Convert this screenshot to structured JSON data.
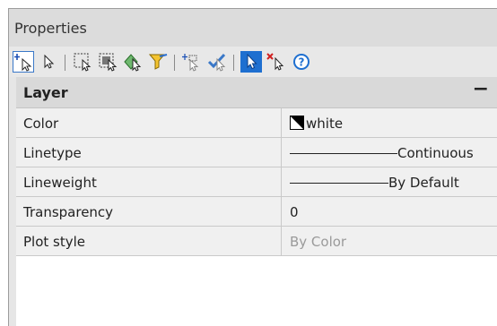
{
  "panel": {
    "title": "Properties"
  },
  "toolbar": {
    "buttons": [
      {
        "name": "quick-select-add-icon"
      },
      {
        "name": "select-objects-icon"
      },
      {
        "name": "window-select-icon"
      },
      {
        "name": "crossing-select-icon"
      },
      {
        "name": "select-similar-icon"
      },
      {
        "name": "filter-select-icon"
      },
      {
        "name": "select-subobjects-icon"
      },
      {
        "name": "pickadd-toggle-icon"
      },
      {
        "name": "pickadd-active-icon"
      },
      {
        "name": "deselect-icon"
      },
      {
        "name": "help-icon"
      }
    ]
  },
  "section": {
    "title": "Layer",
    "collapse_symbol": "−"
  },
  "rows": [
    {
      "label": "Color",
      "value": "white",
      "kind": "color"
    },
    {
      "label": "Linetype",
      "value": "Continuous",
      "kind": "line"
    },
    {
      "label": "Lineweight",
      "value": "By Default",
      "kind": "line"
    },
    {
      "label": "Transparency",
      "value": "0",
      "kind": "text"
    },
    {
      "label": "Plot style",
      "value": "By Color",
      "kind": "muted"
    }
  ],
  "colors": {
    "accent": "#3a78c8",
    "help": "#1e6fd0",
    "deselect": "#d02020"
  }
}
